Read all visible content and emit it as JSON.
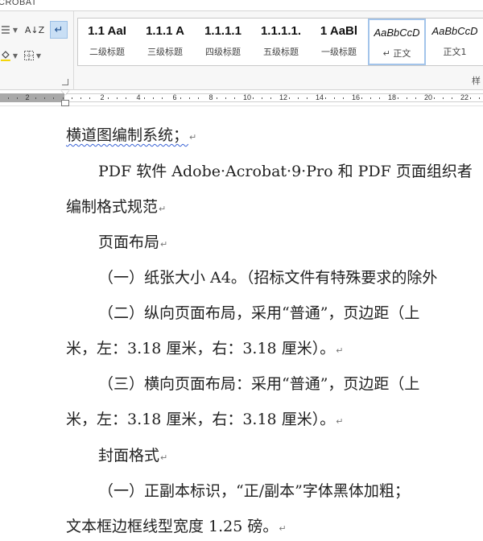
{
  "tab_strip": {
    "label": "CROBAT"
  },
  "ribbon": {
    "paragraph_tools": {
      "sort_icon_label": "A↓Z",
      "show_marks_icon_label": "↵"
    },
    "styles": [
      {
        "preview": "1.1  AaI",
        "name": "二级标题"
      },
      {
        "preview": "1.1.1  A",
        "name": "三级标题"
      },
      {
        "preview": "1.1.1.1",
        "name": "四级标题"
      },
      {
        "preview": "1.1.1.1.",
        "name": "五级标题"
      },
      {
        "preview": "1  AaBl",
        "name": "一级标题"
      },
      {
        "preview": "AaBbCcD",
        "name": "↵ 正文",
        "active": true
      },
      {
        "preview": "AaBbCcD",
        "name": "正文1"
      }
    ],
    "group_label": "样"
  },
  "ruler": {
    "labels": [
      "2",
      "2",
      "4",
      "6",
      "8",
      "10",
      "12",
      "14",
      "16",
      "18",
      "20",
      "22"
    ]
  },
  "document": {
    "lines": [
      {
        "text": "横道图编制系统；",
        "mark": "↵"
      },
      {
        "text": "PDF 软件 Adobe·Acrobat·9·Pro 和 PDF 页面组织者",
        "mark": ""
      },
      {
        "text": "编制格式规范",
        "mark": "↵"
      },
      {
        "text": "页面布局",
        "mark": "↵"
      },
      {
        "text": "（一）纸张大小 A4。（招标文件有特殊要求的除外",
        "mark": ""
      },
      {
        "text": "（二）纵向页面布局，采用“普通”，页边距（上",
        "mark": ""
      },
      {
        "text": "米，左：3.18 厘米，右：3.18 厘米）。",
        "mark": "↵"
      },
      {
        "text": "（三）横向页面布局：采用“普通”，页边距（上",
        "mark": ""
      },
      {
        "text": "米，左：3.18 厘米，右：3.18 厘米）。",
        "mark": "↵"
      },
      {
        "text": "封面格式",
        "mark": "↵"
      },
      {
        "text": "（一）正副本标识，“正/副本”字体黑体加粗；",
        "mark": ""
      },
      {
        "text": "文本框边框线型宽度 1.25 磅。",
        "mark": "↵"
      }
    ]
  },
  "colors": {
    "selection_blue": "#c9dff5",
    "spellcheck_underline": "#3a63d6"
  }
}
